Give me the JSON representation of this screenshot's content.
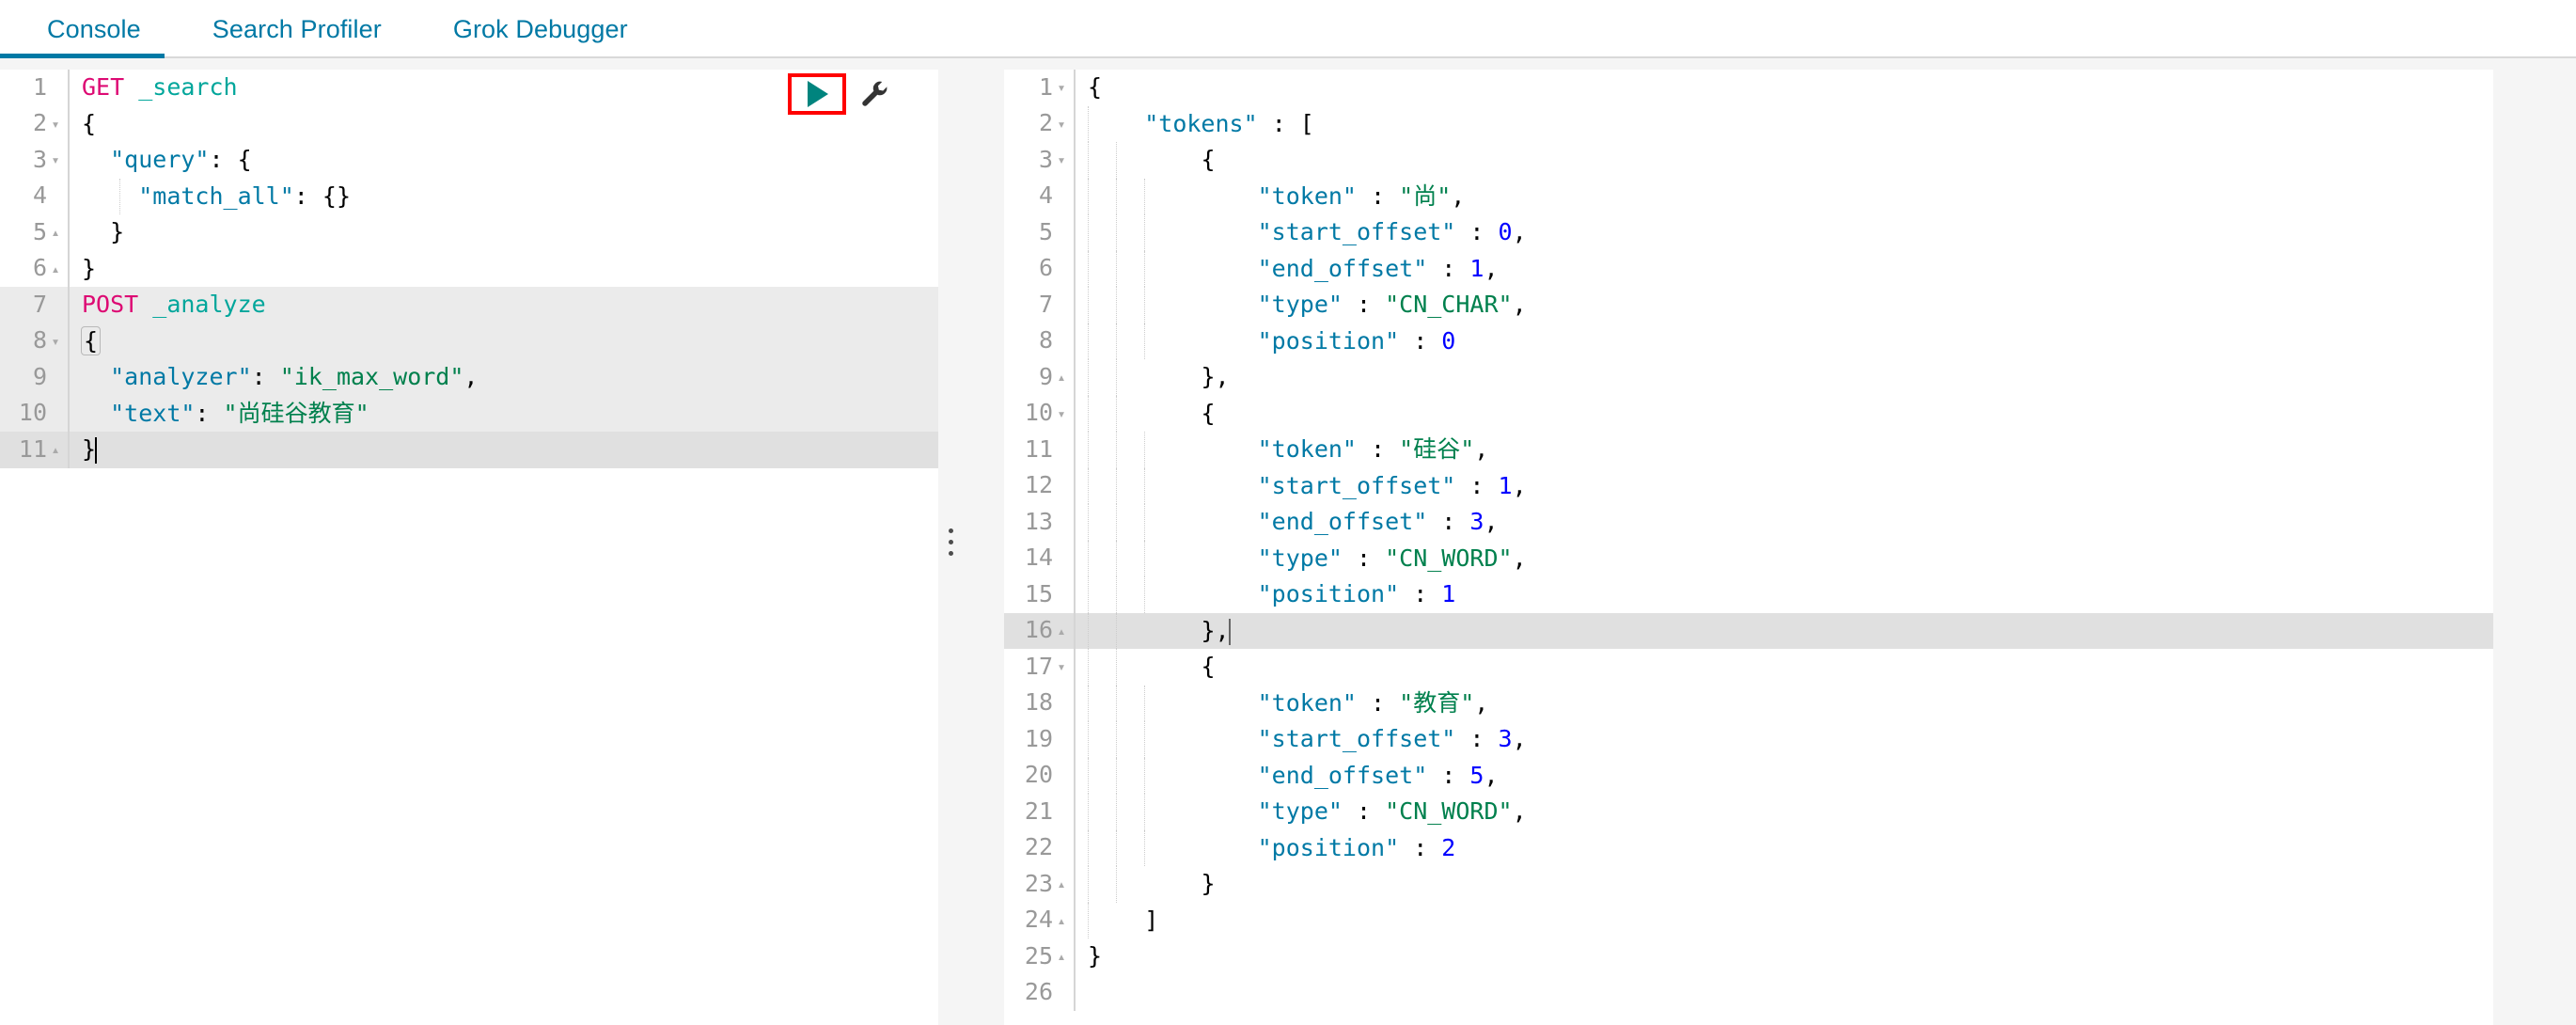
{
  "tabs": [
    {
      "label": "Console",
      "active": true
    },
    {
      "label": "Search Profiler",
      "active": false
    },
    {
      "label": "Grok Debugger",
      "active": false
    }
  ],
  "accent_color": "#0079a5",
  "request_editor": {
    "name": "console-request-editor",
    "lines": [
      {
        "n": "1",
        "fold": "",
        "highlight": "none"
      },
      {
        "n": "2",
        "fold": "▾",
        "highlight": "none"
      },
      {
        "n": "3",
        "fold": "▾",
        "highlight": "none"
      },
      {
        "n": "4",
        "fold": "",
        "highlight": "none"
      },
      {
        "n": "5",
        "fold": "▴",
        "highlight": "none"
      },
      {
        "n": "6",
        "fold": "▴",
        "highlight": "none"
      },
      {
        "n": "7",
        "fold": "",
        "highlight": "block"
      },
      {
        "n": "8",
        "fold": "▾",
        "highlight": "block"
      },
      {
        "n": "9",
        "fold": "",
        "highlight": "block"
      },
      {
        "n": "10",
        "fold": "",
        "highlight": "block"
      },
      {
        "n": "11",
        "fold": "▴",
        "highlight": "cursor"
      }
    ],
    "text": {
      "l1_method": "GET",
      "l1_url": "_search",
      "l2": "{",
      "l3_key": "\"query\"",
      "l3_rest": ": {",
      "l4_key": "\"match_all\"",
      "l4_rest": ": {}",
      "l5": "  }",
      "l6": "}",
      "l7_method": "POST",
      "l7_url": "_analyze",
      "l8": "{",
      "l9_key": "\"analyzer\"",
      "l9_colon": ": ",
      "l9_val": "\"ik_max_word\"",
      "l9_comma": ",",
      "l10_key": "\"text\"",
      "l10_colon": ": ",
      "l10_val": "\"尚硅谷教育\"",
      "l11": "}"
    },
    "actions": {
      "play_label": "play-icon",
      "wrench_label": "wrench-icon",
      "play_color": "#00847e",
      "annotation_color": "#ff0000"
    }
  },
  "response_editor": {
    "name": "console-response-viewer",
    "lines": [
      {
        "n": "1",
        "fold": "▾",
        "highlight": "none"
      },
      {
        "n": "2",
        "fold": "▾",
        "highlight": "none"
      },
      {
        "n": "3",
        "fold": "▾",
        "highlight": "none"
      },
      {
        "n": "4",
        "fold": "",
        "highlight": "none"
      },
      {
        "n": "5",
        "fold": "",
        "highlight": "none"
      },
      {
        "n": "6",
        "fold": "",
        "highlight": "none"
      },
      {
        "n": "7",
        "fold": "",
        "highlight": "none"
      },
      {
        "n": "8",
        "fold": "",
        "highlight": "none"
      },
      {
        "n": "9",
        "fold": "▴",
        "highlight": "none"
      },
      {
        "n": "10",
        "fold": "▾",
        "highlight": "none"
      },
      {
        "n": "11",
        "fold": "",
        "highlight": "none"
      },
      {
        "n": "12",
        "fold": "",
        "highlight": "none"
      },
      {
        "n": "13",
        "fold": "",
        "highlight": "none"
      },
      {
        "n": "14",
        "fold": "",
        "highlight": "none"
      },
      {
        "n": "15",
        "fold": "",
        "highlight": "none"
      },
      {
        "n": "16",
        "fold": "▴",
        "highlight": "cursor"
      },
      {
        "n": "17",
        "fold": "▾",
        "highlight": "none"
      },
      {
        "n": "18",
        "fold": "",
        "highlight": "none"
      },
      {
        "n": "19",
        "fold": "",
        "highlight": "none"
      },
      {
        "n": "20",
        "fold": "",
        "highlight": "none"
      },
      {
        "n": "21",
        "fold": "",
        "highlight": "none"
      },
      {
        "n": "22",
        "fold": "",
        "highlight": "none"
      },
      {
        "n": "23",
        "fold": "▴",
        "highlight": "none"
      },
      {
        "n": "24",
        "fold": "▴",
        "highlight": "none"
      },
      {
        "n": "25",
        "fold": "▴",
        "highlight": "none"
      },
      {
        "n": "26",
        "fold": "",
        "highlight": "none"
      }
    ],
    "json": {
      "open_brace": "{",
      "tokens_key": "\"tokens\"",
      "tokens_colon": " : [",
      "obj_open": "{",
      "obj_close": "}",
      "obj_close_comma": "},",
      "array_close": "]",
      "close_brace": "}",
      "k_token": "\"token\"",
      "k_start": "\"start_offset\"",
      "k_end": "\"end_offset\"",
      "k_type": "\"type\"",
      "k_position": "\"position\"",
      "colon": " : "
    },
    "tokens": [
      {
        "token": "\"尚\"",
        "start_offset": "0",
        "end_offset": "1",
        "type": "\"CN_CHAR\"",
        "position": "0"
      },
      {
        "token": "\"硅谷\"",
        "start_offset": "1",
        "end_offset": "3",
        "type": "\"CN_WORD\"",
        "position": "1"
      },
      {
        "token": "\"教育\"",
        "start_offset": "3",
        "end_offset": "5",
        "type": "\"CN_WORD\"",
        "position": "2"
      }
    ]
  },
  "splitter": {
    "name": "pane-resize-handle"
  },
  "syntax_colors": {
    "method": "#dd0a73",
    "url": "#00a69b",
    "key": "#0079a5",
    "string": "#00804d",
    "number": "#0000ff"
  }
}
